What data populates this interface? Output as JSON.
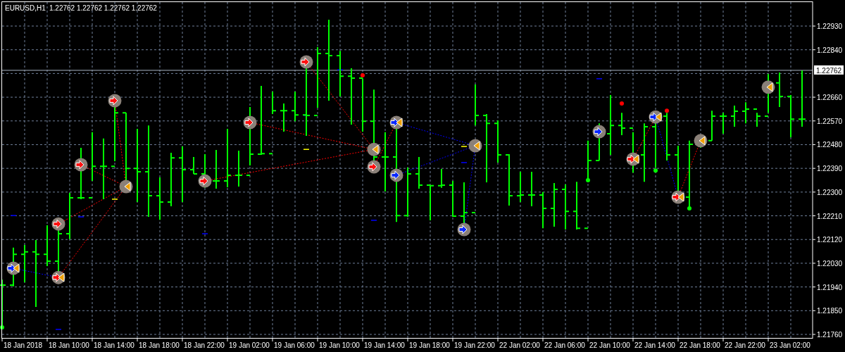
{
  "chart": {
    "symbol": "EURUSD,H1",
    "quote": "1.22762 1.22762 1.22762 1.22762",
    "current_price": "1.22762",
    "price_axis": [
      "1.22930",
      "1.22840",
      "1.22660",
      "1.22570",
      "1.22480",
      "1.22390",
      "1.22300",
      "1.22210",
      "1.22120",
      "1.22030",
      "1.21940",
      "1.21850",
      "1.21760"
    ],
    "time_axis": [
      "18 Jan 2018",
      "18 Jan 10:00",
      "18 Jan 14:00",
      "18 Jan 18:00",
      "18 Jan 22:00",
      "19 Jan 02:00",
      "19 Jan 06:00",
      "19 Jan 10:00",
      "19 Jan 14:00",
      "19 Jan 18:00",
      "19 Jan 22:00",
      "22 Jan 02:00",
      "22 Jan 06:00",
      "22 Jan 10:00",
      "22 Jan 14:00",
      "22 Jan 18:00",
      "22 Jan 22:00",
      "23 Jan 02:00"
    ]
  }
}
